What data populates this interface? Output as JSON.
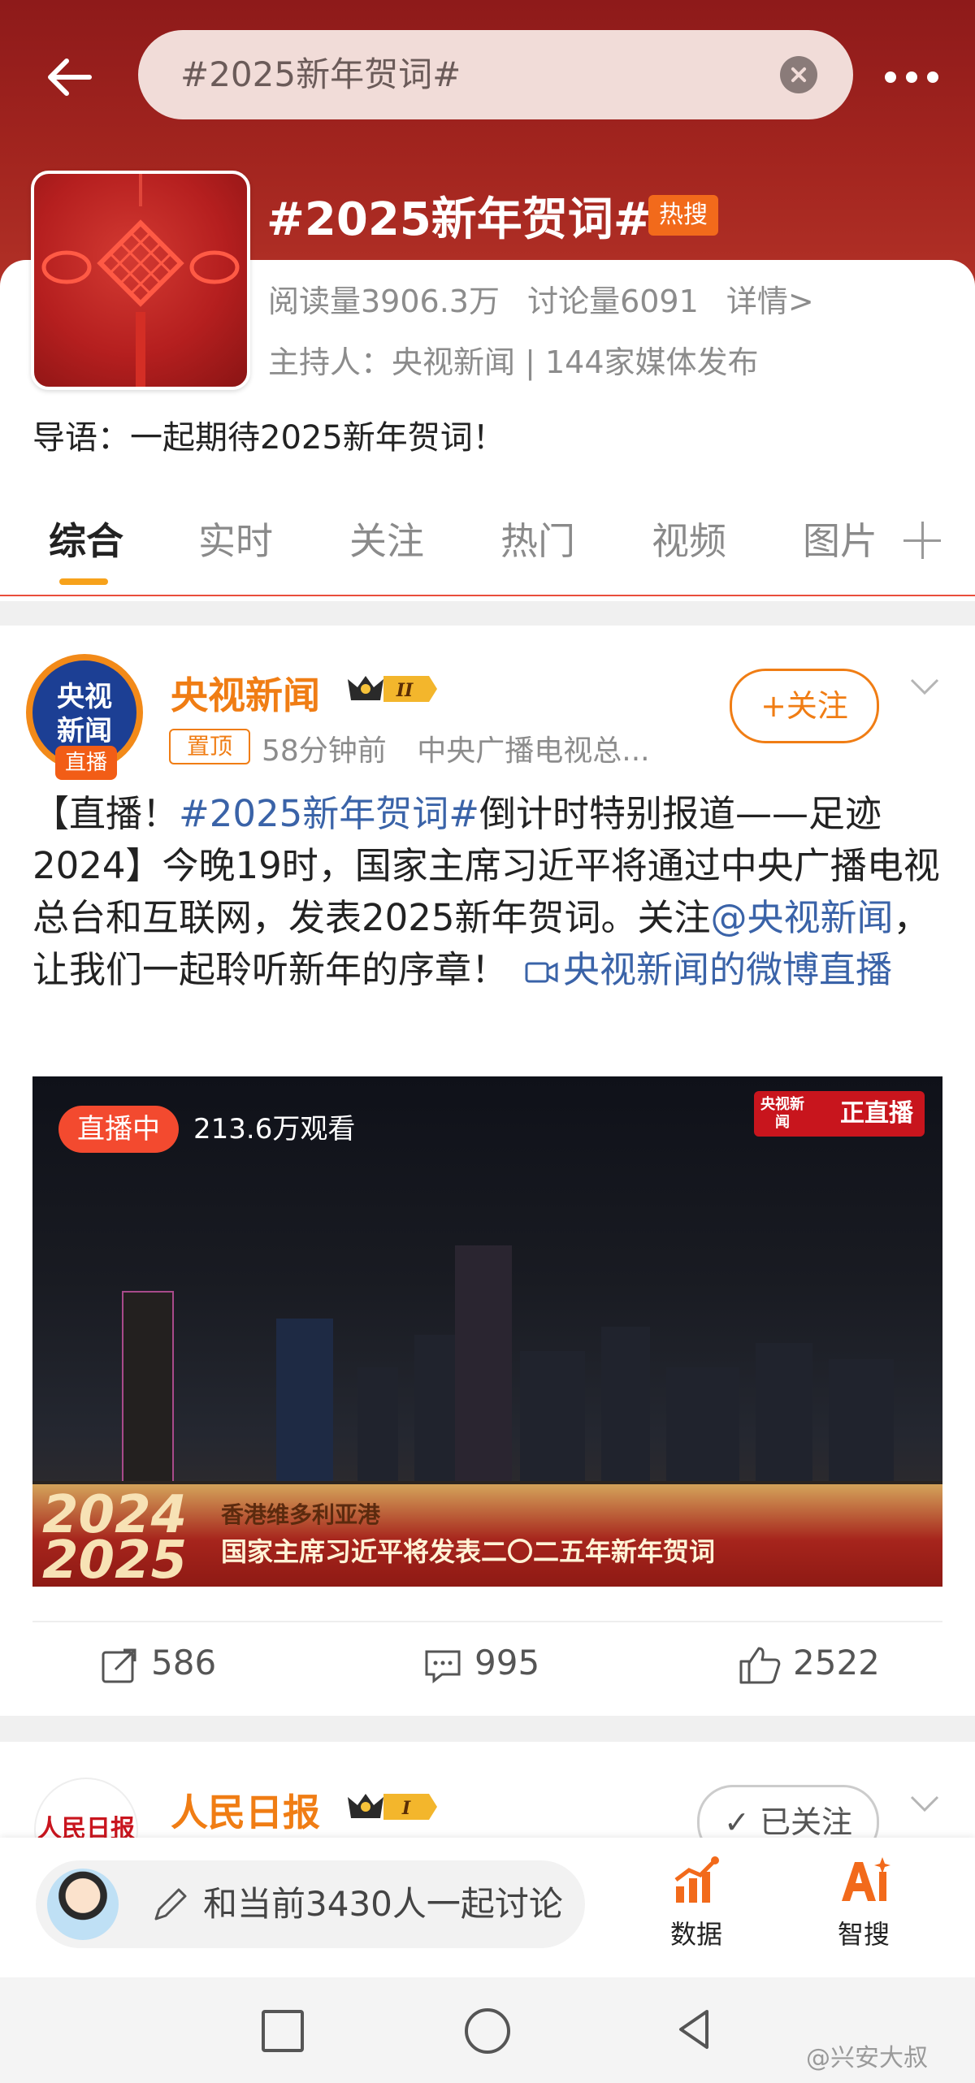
{
  "header": {
    "search_text": "#2025新年贺词#"
  },
  "topic": {
    "title": "#2025新年贺词#",
    "hot_badge": "热搜",
    "reads": "阅读量3906.3万",
    "discussions": "讨论量6091",
    "details": "详情>",
    "host": "主持人：央视新闻 | 144家媒体发布",
    "intro": "导语：一起期待2025新年贺词！"
  },
  "tabs": [
    "综合",
    "实时",
    "关注",
    "热门",
    "视频",
    "图片"
  ],
  "post1": {
    "avatar_text": "央视新闻",
    "avatar_live": "直播",
    "username": "央视新闻",
    "vip_level": "II",
    "pinned": "置顶",
    "time": "58分钟前",
    "source": "中央广播电视总...",
    "follow_label": "+关注",
    "text_1": "【直播！",
    "text_hashtag": "#2025新年贺词#",
    "text_2": "倒计时特别报道——足迹2024】今晚19时，国家主席习近平将通过中央广播电视总台和互联网，发表2025新年贺词。关注",
    "text_mention": "@央视新闻",
    "text_3": "，让我们一起聆听新年的序章！",
    "text_live_link": "央视新闻的微博直播",
    "video": {
      "live_label": "直播中",
      "viewers": "213.6万观看",
      "logo_small": "央视新闻",
      "logo_text": "正直播",
      "years_top": "2024",
      "years_bottom": "2025",
      "location": "香港维多利亚港",
      "caption": "国家主席习近平将发表二〇二五年新年贺词"
    },
    "reposts": "586",
    "comments": "995",
    "likes": "2522"
  },
  "post2": {
    "avatar_text": "人民日报",
    "username": "人民日报",
    "vip_level": "I",
    "followed_label": "已关注"
  },
  "bottom": {
    "input_placeholder": "和当前3430人一起讨论",
    "data_label": "数据",
    "ai_label": "智搜"
  },
  "watermark": "@兴安大叔",
  "colors": {
    "header_red": "#a3251f",
    "accent_orange": "#f07d14",
    "link_blue": "#3a63a8",
    "tab_indicator": "#f7a21b"
  }
}
